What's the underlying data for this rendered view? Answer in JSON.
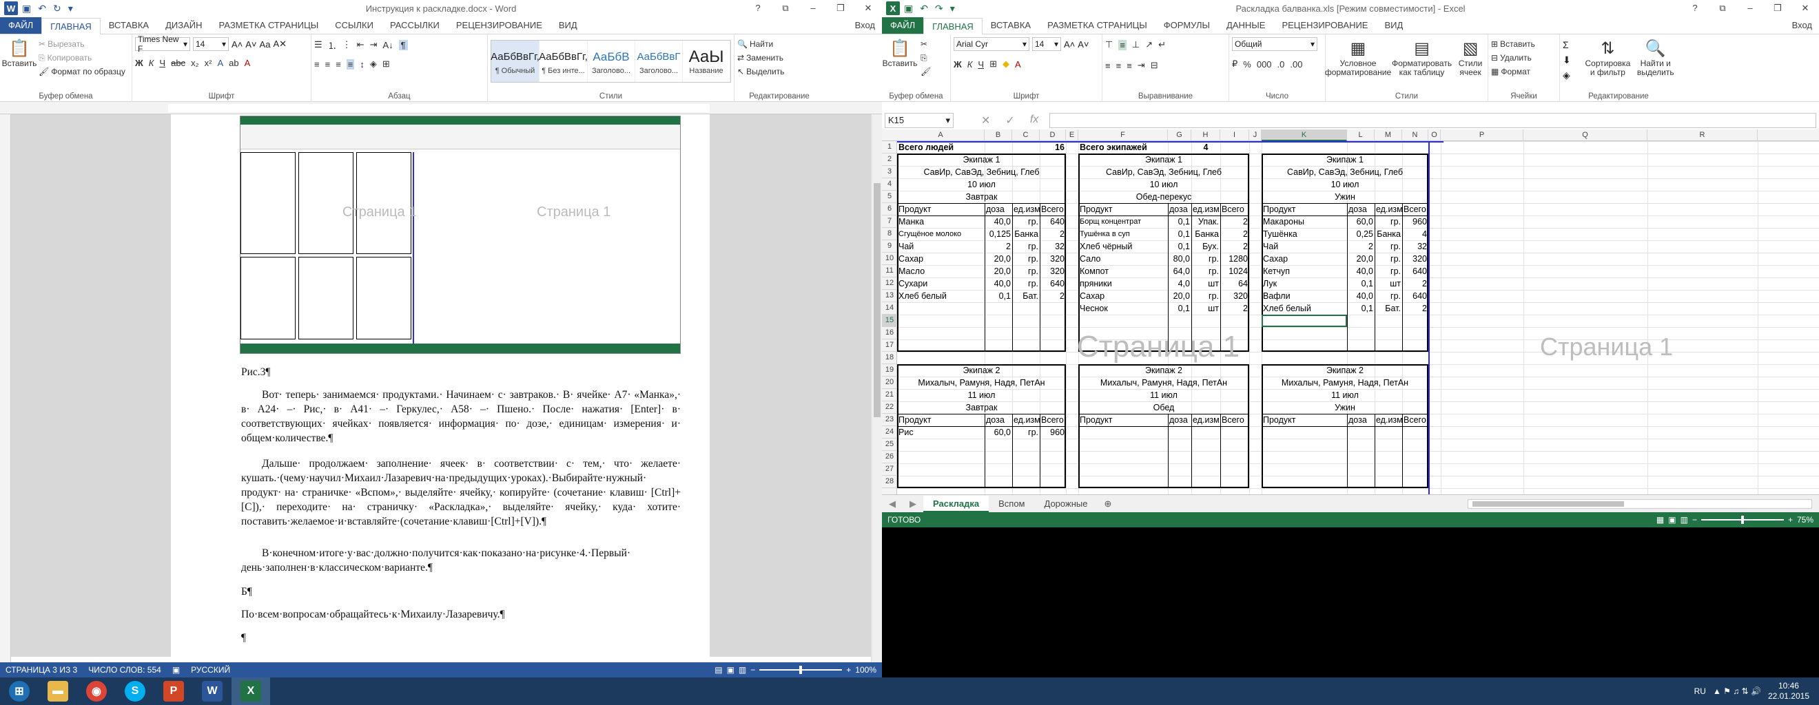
{
  "word": {
    "title": "Инструкция к раскладке.docx - Word",
    "login": "Вход",
    "tabs": [
      "ФАЙЛ",
      "ГЛАВНАЯ",
      "ВСТАВКА",
      "ДИЗАЙН",
      "РАЗМЕТКА СТРАНИЦЫ",
      "ССЫЛКИ",
      "РАССЫЛКИ",
      "РЕЦЕНЗИРОВАНИЕ",
      "ВИД"
    ],
    "clipboard": {
      "paste": "Вставить",
      "cut": "Вырезать",
      "copy": "Копировать",
      "format_painter": "Формат по образцу",
      "label": "Буфер обмена"
    },
    "font": {
      "name": "Times New F",
      "size": "14",
      "label": "Шрифт"
    },
    "paragraph_label": "Абзац",
    "styles": [
      {
        "sample": "АаБбВвГг,",
        "name": "¶ Обычный"
      },
      {
        "sample": "АаБбВвГг,",
        "name": "¶ Без инте..."
      },
      {
        "sample": "АаБбВ",
        "name": "Заголово..."
      },
      {
        "sample": "АаБбВвГ",
        "name": "Заголово..."
      },
      {
        "sample": "АаЫ",
        "name": "Название"
      }
    ],
    "styles_label": "Стили",
    "editing": {
      "find": "Найти",
      "replace": "Заменить",
      "select": "Выделить",
      "label": "Редактирование"
    },
    "doc": {
      "caption": "Рис.3¶",
      "p1": "Вот· теперь· занимаемся· продуктами.· Начинаем· с· завтраков.· В· ячейке· А7· «Манка»,· в· А24· –· Рис,· в· А41· –· Геркулес,· А58· –· Пшено.· После· нажатия· [Enter]· в· соответствующих· ячейках· появляется· информация· по· дозе,· единицам· измерения· и· общем·количестве.¶",
      "p2": "Дальше· продолжаем· заполнение· ячеек· в· соответствии· с· тем,· что· желаете· кушать.·(чему·научил·Михаил·Лазаревич·на·предыдущих·уроках).·Выбирайте·нужный· продукт· на· страничке· «Вспом»,· выделяйте· ячейку,· копируйте· (сочетание· клавиш· [Ctrl]+[C]),· переходите· на· страничку· «Раскладка»,· выделяйте· ячейку,· куда· хотите· поставить·желаемое·и·вставляйте·(сочетание·клавиш·[Ctrl]+[V]).¶",
      "p3": "В·конечном·итоге·у·вас·должно·получится·как·показано·на·рисунке·4.·Первый· день·заполнен·в·классическом·варианте.¶",
      "p4": "Б¶",
      "p5": "По·всем·вопросам·обращайтесь·к·Михаилу·Лазаревичу.¶",
      "p6": "¶"
    },
    "status": {
      "page": "СТРАНИЦА 3 ИЗ 3",
      "words": "ЧИСЛО СЛОВ: 554",
      "lang": "РУССКИЙ",
      "zoom": "100%"
    }
  },
  "excel": {
    "title": "Раскладка балванка.xls  [Режим совместимости] - Excel",
    "login": "Вход",
    "tabs": [
      "ФАЙЛ",
      "ГЛАВНАЯ",
      "ВСТАВКА",
      "РАЗМЕТКА СТРАНИЦЫ",
      "ФОРМУЛЫ",
      "ДАННЫЕ",
      "РЕЦЕНЗИРОВАНИЕ",
      "ВИД"
    ],
    "clipboard_label": "Буфер обмена",
    "paste": "Вставить",
    "font": {
      "name": "Arial Cyr",
      "size": "14",
      "label": "Шрифт"
    },
    "alignment_label": "Выравнивание",
    "number": {
      "format": "Общий",
      "label": "Число"
    },
    "styles": {
      "cond": "Условное форматирование",
      "table": "Форматировать как таблицу",
      "cell": "Стили ячеек",
      "label": "Стили"
    },
    "cells": {
      "insert": "Вставить",
      "delete": "Удалить",
      "format": "Формат",
      "label": "Ячейки"
    },
    "editing": {
      "sort": "Сортировка и фильтр",
      "find": "Найти и выделить",
      "label": "Редактирование"
    },
    "namebox": "K15",
    "fx": "fx",
    "columns": [
      "A",
      "B",
      "C",
      "D",
      "E",
      "F",
      "G",
      "H",
      "I",
      "J",
      "K",
      "L",
      "M",
      "N",
      "O",
      "P",
      "Q",
      "R"
    ],
    "rows": [
      "1",
      "2",
      "3",
      "4",
      "5",
      "6",
      "7",
      "8",
      "9",
      "10",
      "11",
      "12",
      "13",
      "14",
      "15",
      "16",
      "17",
      "18",
      "19",
      "20",
      "21",
      "22",
      "23",
      "24",
      "25",
      "26",
      "27",
      "28"
    ],
    "header": {
      "people": "Всего людей",
      "people_n": "16",
      "crews": "Всего экипажей",
      "crews_n": "4"
    },
    "blocks": [
      {
        "crew": "Экипаж 1",
        "names": "СавИр, СавЭд, Зебниц, Глеб",
        "date": "10 июл",
        "meal": "Завтрак"
      },
      {
        "crew": "Экипаж 1",
        "names": "СавИр, СавЭд, Зебниц, Глеб",
        "date": "10 июл",
        "meal": "Обед-перекус"
      },
      {
        "crew": "Экипаж 1",
        "names": "СавИр, СавЭд, Зебниц, Глеб",
        "date": "10 июл",
        "meal": "Ужин"
      },
      {
        "crew": "Экипаж 2",
        "names": "Михалыч, Рамуня, Надя, ПетАн",
        "date": "11 июл",
        "meal": "Завтрак"
      },
      {
        "crew": "Экипаж 2",
        "names": "Михалыч, Рамуня, Надя, ПетАн",
        "date": "11 июл",
        "meal": "Обед"
      },
      {
        "crew": "Экипаж 2",
        "names": "Михалыч, Рамуня, Надя, ПетАн",
        "date": "11 июл",
        "meal": "Ужин"
      }
    ],
    "colheads": {
      "product": "Продукт",
      "dose": "доза",
      "unit": "ед.изм.",
      "total": "Всего"
    },
    "breakfast": [
      [
        "Манка",
        "40,0",
        "гр.",
        "640"
      ],
      [
        "Сгущёное молоко",
        "0,125",
        "Банка",
        "2"
      ],
      [
        "Чай",
        "2",
        "гр.",
        "32"
      ],
      [
        "Сахар",
        "20,0",
        "гр.",
        "320"
      ],
      [
        "Масло",
        "20,0",
        "гр.",
        "320"
      ],
      [
        "Сухари",
        "40,0",
        "гр.",
        "640"
      ],
      [
        "Хлеб белый",
        "0,1",
        "Бат.",
        "2"
      ]
    ],
    "lunch": [
      [
        "Борщ концентрат",
        "0,1",
        "Упак.",
        "2"
      ],
      [
        "Тушёнка в суп",
        "0,1",
        "Банка",
        "2"
      ],
      [
        "Хлеб чёрный",
        "0,1",
        "Бух.",
        "2"
      ],
      [
        "Сало",
        "80,0",
        "гр.",
        "1280"
      ],
      [
        "Компот",
        "64,0",
        "гр.",
        "1024"
      ],
      [
        "пряники",
        "4,0",
        "шт",
        "64"
      ],
      [
        "Сахар",
        "20,0",
        "гр.",
        "320"
      ],
      [
        "Чеснок",
        "0,1",
        "шт",
        "2"
      ]
    ],
    "dinner": [
      [
        "Макароны",
        "60,0",
        "гр.",
        "960"
      ],
      [
        "Тушёнка",
        "0,25",
        "Банка",
        "4"
      ],
      [
        "Чай",
        "2",
        "гр.",
        "32"
      ],
      [
        "Сахар",
        "20,0",
        "гр.",
        "320"
      ],
      [
        "Кетчуп",
        "40,0",
        "гр.",
        "640"
      ],
      [
        "Лук",
        "0,1",
        "шт",
        "2"
      ],
      [
        "Вафли",
        "40,0",
        "гр.",
        "640"
      ],
      [
        "Хлеб белый",
        "0,1",
        "Бат.",
        "2"
      ]
    ],
    "breakfast2": [
      [
        "Рис",
        "60,0",
        "гр.",
        "960"
      ]
    ],
    "watermark": "Страница 1",
    "sheets": [
      "Раскладка",
      "Вспом",
      "Дорожные"
    ],
    "status": {
      "ready": "ГОТОВО",
      "zoom": "75%"
    }
  },
  "taskbar": {
    "lang": "RU",
    "time": "10:46",
    "date": "22.01.2015"
  },
  "colors": {
    "word_blue": "#2b579a",
    "excel_green": "#217346"
  }
}
